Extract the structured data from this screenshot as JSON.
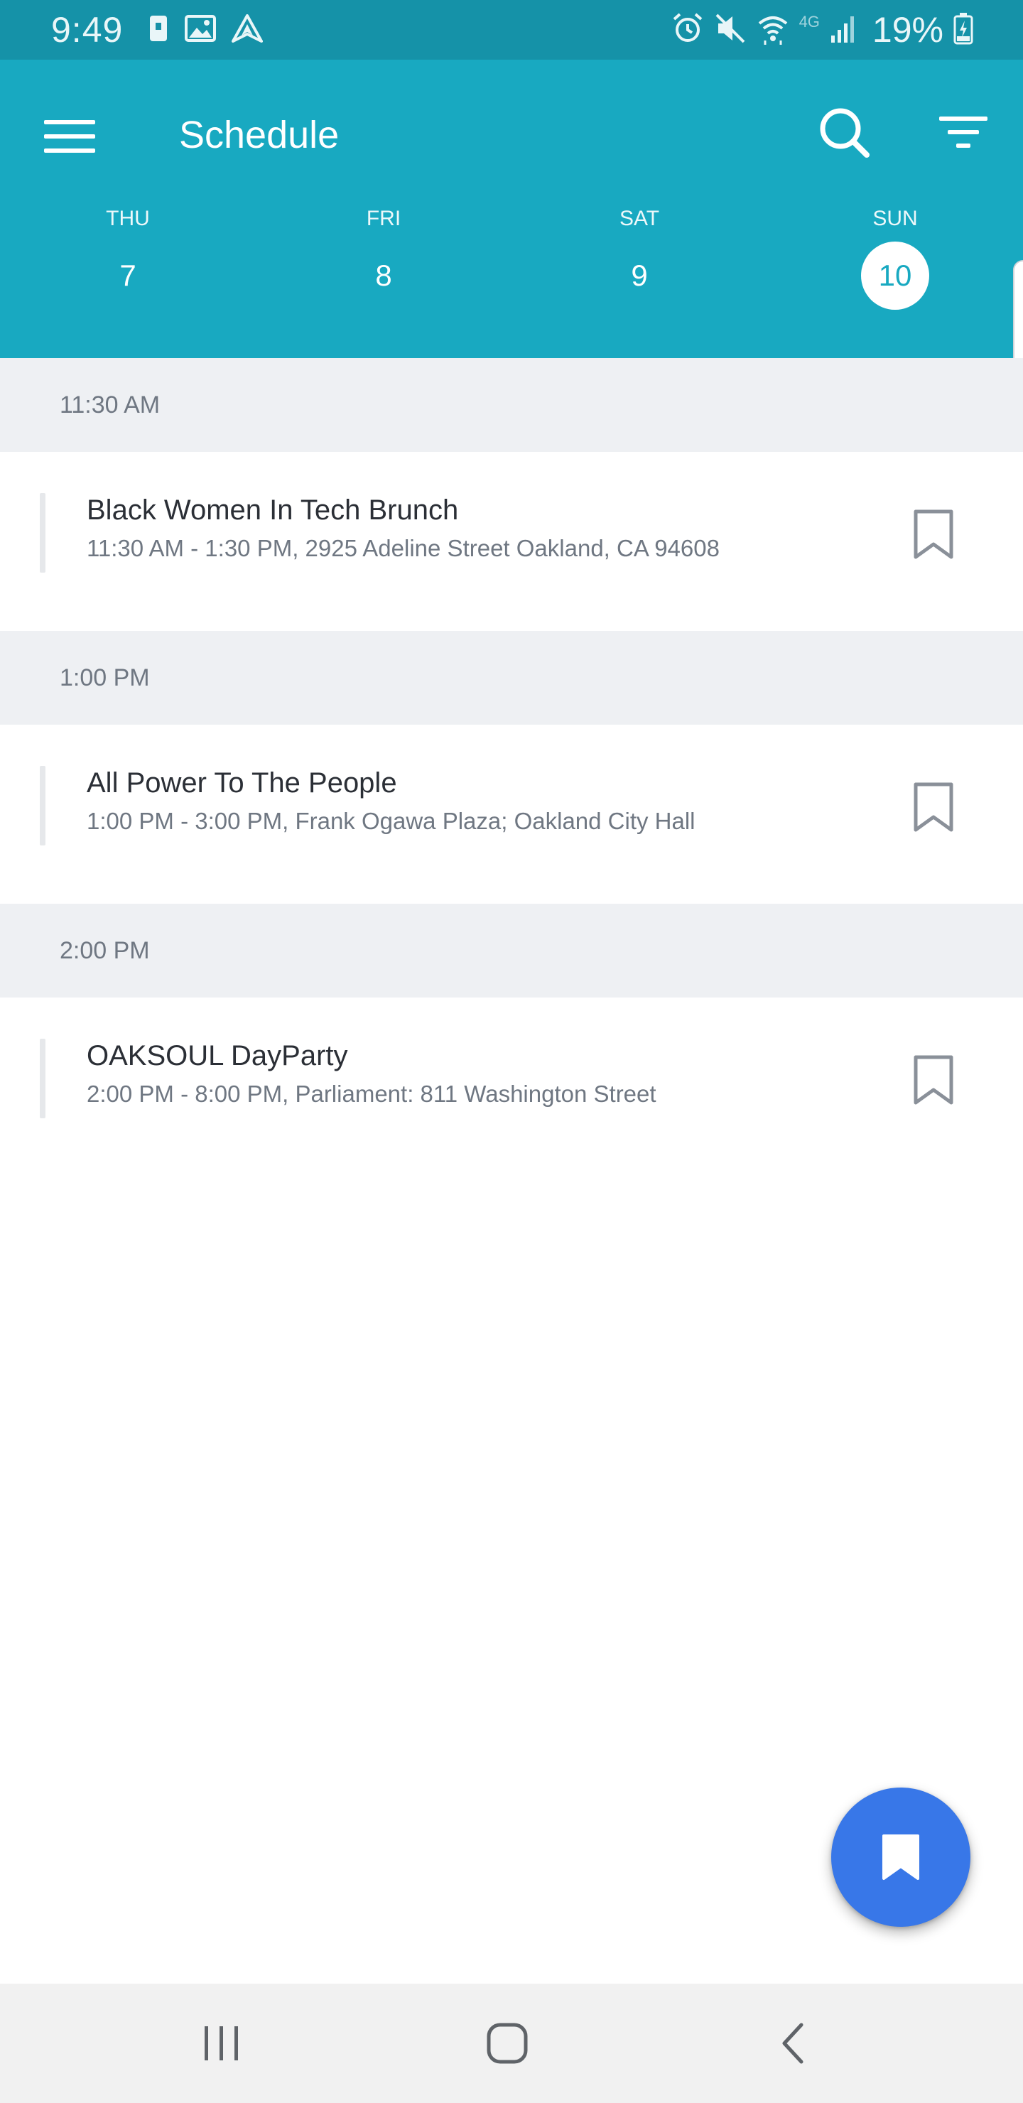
{
  "status_bar": {
    "time": "9:49",
    "network_label": "4G",
    "battery": "19%",
    "icons": [
      "notification-icon",
      "image-icon",
      "navigation-icon",
      "alarm-icon",
      "mute-icon",
      "wifi-icon",
      "signal-icon",
      "battery-icon"
    ]
  },
  "app_bar": {
    "title": "Schedule",
    "menu_icon": "hamburger-menu-icon",
    "search_icon": "search-icon",
    "filter_icon": "filter-icon",
    "background_color": "#18a9c1"
  },
  "days": [
    {
      "dow": "THU",
      "num": "7",
      "active": false
    },
    {
      "dow": "FRI",
      "num": "8",
      "active": false
    },
    {
      "dow": "SAT",
      "num": "9",
      "active": false
    },
    {
      "dow": "SUN",
      "num": "10",
      "active": true
    }
  ],
  "schedule": [
    {
      "time": "11:30 AM",
      "events": [
        {
          "title": "Black Women In Tech Brunch",
          "meta": "11:30 AM - 1:30 PM, 2925 Adeline Street Oakland, CA 94608",
          "bookmarked": false
        }
      ]
    },
    {
      "time": "1:00 PM",
      "events": [
        {
          "title": "All Power To The People",
          "meta": "1:00 PM - 3:00 PM, Frank Ogawa Plaza; Oakland City Hall",
          "bookmarked": false
        }
      ]
    },
    {
      "time": "2:00 PM",
      "events": [
        {
          "title": "OAKSOUL DayParty",
          "meta": "2:00 PM - 8:00 PM, Parliament: 811 Washington Street",
          "bookmarked": false
        }
      ]
    }
  ],
  "fab": {
    "icon": "bookmark-icon",
    "color": "#3877e8"
  },
  "nav_bar": {
    "recents_icon": "recents-icon",
    "home_icon": "home-icon",
    "back_icon": "back-icon"
  }
}
